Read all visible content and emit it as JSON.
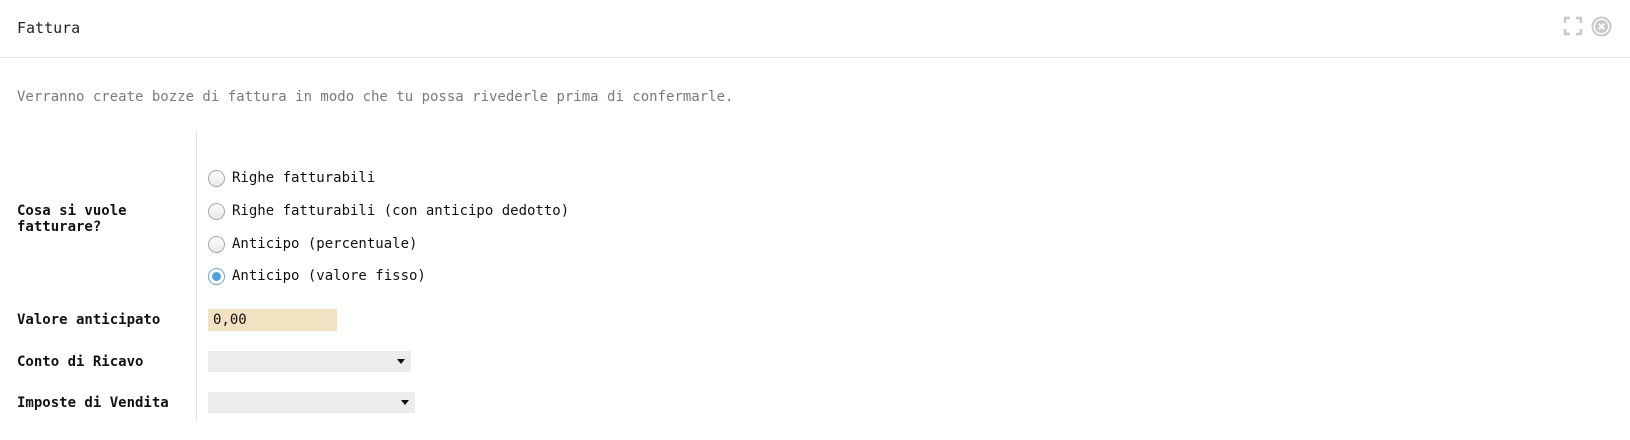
{
  "dialog": {
    "title": "Fattura",
    "intro": "Verranno create bozze di fattura in modo che tu possa rivederle prima di confermarle."
  },
  "form": {
    "invoice_question": {
      "label": "Cosa si vuole fatturare?",
      "options": [
        {
          "label": "Righe fatturabili",
          "selected": false
        },
        {
          "label": "Righe fatturabili (con anticipo dedotto)",
          "selected": false
        },
        {
          "label": "Anticipo (percentuale)",
          "selected": false
        },
        {
          "label": "Anticipo (valore fisso)",
          "selected": true
        }
      ]
    },
    "advance_amount": {
      "label": "Valore anticipato",
      "value": "0,00"
    },
    "revenue_account": {
      "label": "Conto di Ricavo",
      "value": ""
    },
    "sales_taxes": {
      "label": "Imposte di Vendita",
      "value": ""
    }
  },
  "icons": {
    "expand": "expand-icon",
    "close": "close-icon",
    "caret": "caret-down-icon"
  },
  "colors": {
    "radio_selected": "#4aa3e0",
    "required_input_bg": "#f2e2c2",
    "select_bg": "#ececec",
    "muted_text": "#7a7a7a"
  }
}
